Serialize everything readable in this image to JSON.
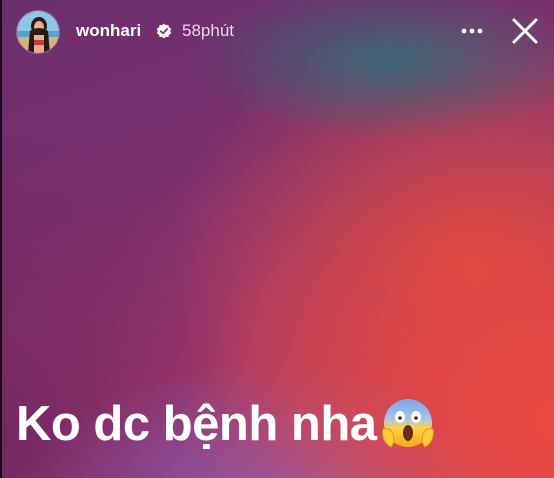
{
  "header": {
    "username": "wonhari",
    "time": "58phút",
    "verified_icon": "verified-badge-icon",
    "more_icon": "more-options-icon",
    "close_icon": "close-icon"
  },
  "story": {
    "caption": "Ko dc bệnh nha",
    "emoji": "😱",
    "emoji_icon": "face-screaming-in-fear-icon"
  },
  "colors": {
    "text": "#ffffff",
    "background_purple": "#6b2f6e",
    "background_red": "#e5473f",
    "background_teal": "#2e6e78"
  }
}
